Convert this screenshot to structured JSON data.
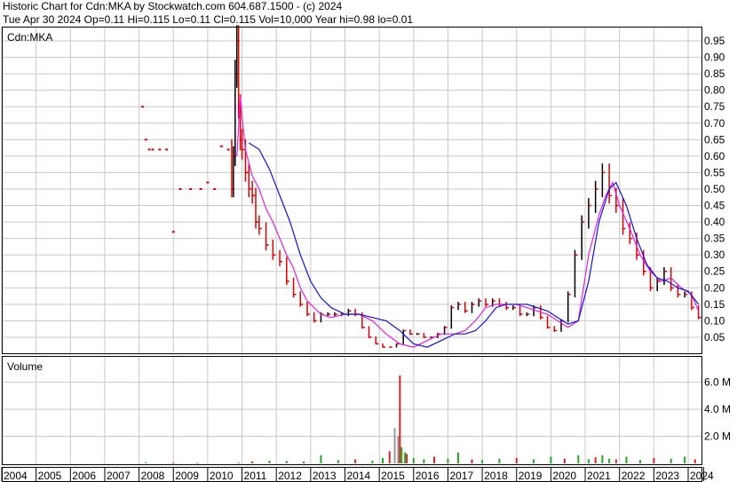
{
  "header": {
    "line1": "Historic Chart for Cdn:MKA by Stockwatch.com 604.687.1500 - (c) 2024",
    "line2": "Tue Apr 30 2024  Op=0.11  Hi=0.115  Lo=0.11  Cl=0.115  Vol=10,000  Year hi=0.98  lo=0.01"
  },
  "colors": {
    "background": "#ffffff",
    "grid": "#c8c8c8",
    "frame": "#000000",
    "price_bar_up": "#000000",
    "price_bar_down": "#dd0000",
    "ma_short": "#e020e0",
    "ma_long": "#1010dd",
    "volume_up": "#22aa22",
    "volume_down": "#dd2222",
    "volume_neutral": "#999999"
  },
  "chart_data": [
    {
      "type": "line",
      "title": "Cdn:MKA",
      "ylim": [
        0,
        0.98
      ],
      "y_ticks": [
        "0.95",
        "0.90",
        "0.85",
        "0.80",
        "0.75",
        "0.70",
        "0.65",
        "0.60",
        "0.55",
        "0.50",
        "0.45",
        "0.40",
        "0.35",
        "0.30",
        "0.25",
        "0.20",
        "0.15",
        "0.10",
        "0.05"
      ],
      "x_ticks": [
        "2004",
        "2005",
        "2006",
        "2007",
        "2008",
        "2009",
        "2010",
        "2011",
        "2012",
        "2013",
        "2014",
        "2015",
        "2016",
        "2017",
        "2018",
        "2019",
        "2020",
        "2021",
        "2022",
        "2023",
        "2024"
      ],
      "grid": true,
      "series": [
        {
          "role": "price",
          "x": [
            2008.1,
            2008.2,
            2008.3,
            2008.4,
            2008.6,
            2008.8,
            2009.0,
            2009.2,
            2009.5,
            2009.8,
            2010.0,
            2010.2,
            2010.4,
            2010.6,
            2010.7,
            2010.75,
            2010.8,
            2010.85,
            2010.9,
            2010.95,
            2011.0,
            2011.1,
            2011.2,
            2011.3,
            2011.4,
            2011.5,
            2011.7,
            2011.9,
            2012.1,
            2012.3,
            2012.5,
            2012.7,
            2012.9,
            2013.1,
            2013.3,
            2013.5,
            2013.7,
            2013.9,
            2014.1,
            2014.3,
            2014.5,
            2014.7,
            2014.9,
            2015.1,
            2015.3,
            2015.5,
            2015.7,
            2015.9,
            2016.1,
            2016.3,
            2016.5,
            2016.7,
            2016.9,
            2017.1,
            2017.3,
            2017.5,
            2017.7,
            2017.9,
            2018.1,
            2018.3,
            2018.5,
            2018.7,
            2018.9,
            2019.1,
            2019.3,
            2019.5,
            2019.7,
            2019.9,
            2020.1,
            2020.3,
            2020.5,
            2020.7,
            2020.9,
            2021.1,
            2021.3,
            2021.5,
            2021.7,
            2021.9,
            2022.1,
            2022.3,
            2022.5,
            2022.7,
            2022.9,
            2023.1,
            2023.3,
            2023.5,
            2023.7,
            2023.9,
            2024.1,
            2024.3
          ],
          "values": [
            0.75,
            0.65,
            0.62,
            0.62,
            0.62,
            0.62,
            0.37,
            0.5,
            0.5,
            0.5,
            0.52,
            0.5,
            0.63,
            0.62,
            0.5,
            0.6,
            0.85,
            0.95,
            0.75,
            0.65,
            0.62,
            0.55,
            0.5,
            0.48,
            0.4,
            0.38,
            0.33,
            0.3,
            0.28,
            0.22,
            0.18,
            0.15,
            0.12,
            0.1,
            0.12,
            0.12,
            0.12,
            0.12,
            0.13,
            0.12,
            0.08,
            0.05,
            0.03,
            0.02,
            0.02,
            0.03,
            0.07,
            0.06,
            0.06,
            0.05,
            0.05,
            0.06,
            0.08,
            0.14,
            0.15,
            0.13,
            0.15,
            0.16,
            0.15,
            0.16,
            0.15,
            0.14,
            0.14,
            0.12,
            0.12,
            0.14,
            0.11,
            0.08,
            0.07,
            0.1,
            0.18,
            0.3,
            0.4,
            0.45,
            0.5,
            0.55,
            0.48,
            0.45,
            0.38,
            0.35,
            0.3,
            0.25,
            0.2,
            0.22,
            0.25,
            0.2,
            0.18,
            0.18,
            0.14,
            0.11
          ]
        },
        {
          "role": "moving-average-short",
          "x": [
            2010.85,
            2010.95,
            2011.0,
            2011.1,
            2011.3,
            2011.5,
            2011.7,
            2011.9,
            2012.1,
            2012.3,
            2012.5,
            2012.7,
            2012.9,
            2013.1,
            2013.3,
            2013.6,
            2014.0,
            2014.4,
            2014.8,
            2015.2,
            2015.6,
            2016.0,
            2016.4,
            2016.8,
            2017.2,
            2017.5,
            2017.8,
            2018.1,
            2018.4,
            2018.7,
            2019.0,
            2019.3,
            2019.6,
            2019.9,
            2020.2,
            2020.5,
            2020.8,
            2021.1,
            2021.4,
            2021.6,
            2021.8,
            2022.0,
            2022.3,
            2022.6,
            2022.9,
            2023.2,
            2023.5,
            2023.8,
            2024.1,
            2024.3
          ],
          "values": [
            0.6,
            0.78,
            0.72,
            0.62,
            0.54,
            0.5,
            0.44,
            0.4,
            0.35,
            0.3,
            0.26,
            0.2,
            0.16,
            0.14,
            0.12,
            0.11,
            0.12,
            0.12,
            0.1,
            0.06,
            0.03,
            0.02,
            0.04,
            0.06,
            0.06,
            0.07,
            0.1,
            0.14,
            0.15,
            0.15,
            0.15,
            0.14,
            0.13,
            0.12,
            0.1,
            0.08,
            0.1,
            0.3,
            0.42,
            0.48,
            0.52,
            0.45,
            0.38,
            0.3,
            0.25,
            0.22,
            0.23,
            0.2,
            0.18,
            0.13
          ]
        },
        {
          "role": "moving-average-long",
          "x": [
            2011.2,
            2011.5,
            2011.8,
            2012.1,
            2012.4,
            2012.7,
            2013.0,
            2013.3,
            2013.6,
            2014.0,
            2014.4,
            2014.8,
            2015.2,
            2015.6,
            2016.0,
            2016.4,
            2016.8,
            2017.2,
            2017.5,
            2017.8,
            2018.1,
            2018.4,
            2018.7,
            2019.0,
            2019.3,
            2019.6,
            2019.9,
            2020.2,
            2020.5,
            2020.8,
            2021.1,
            2021.4,
            2021.7,
            2021.9,
            2022.2,
            2022.5,
            2022.8,
            2023.1,
            2023.4,
            2023.7,
            2024.0,
            2024.3
          ],
          "values": [
            0.64,
            0.62,
            0.56,
            0.48,
            0.4,
            0.3,
            0.22,
            0.17,
            0.14,
            0.12,
            0.12,
            0.11,
            0.1,
            0.07,
            0.03,
            0.02,
            0.04,
            0.06,
            0.06,
            0.07,
            0.1,
            0.14,
            0.15,
            0.15,
            0.15,
            0.14,
            0.13,
            0.11,
            0.09,
            0.1,
            0.22,
            0.4,
            0.5,
            0.52,
            0.45,
            0.35,
            0.27,
            0.23,
            0.22,
            0.2,
            0.19,
            0.15
          ]
        }
      ]
    },
    {
      "type": "bar",
      "title": "Volume",
      "ylim": [
        0,
        7000000
      ],
      "y_ticks": [
        "6.0 M",
        "4.0 M",
        "2.0 M"
      ],
      "grid": true,
      "series": [
        {
          "name": "Volume",
          "x": [
            2008.2,
            2009.0,
            2009.7,
            2010.9,
            2011.3,
            2011.8,
            2012.3,
            2012.8,
            2013.3,
            2013.8,
            2014.3,
            2014.8,
            2015.1,
            2015.3,
            2015.45,
            2015.55,
            2015.6,
            2015.65,
            2015.75,
            2015.8,
            2016.0,
            2016.3,
            2016.6,
            2017.0,
            2017.3,
            2017.7,
            2018.0,
            2018.5,
            2019.0,
            2019.5,
            2020.0,
            2020.4,
            2020.8,
            2021.1,
            2021.3,
            2021.5,
            2021.7,
            2021.9,
            2022.2,
            2022.6,
            2023.0,
            2023.5,
            2023.9,
            2024.2
          ],
          "values": [
            80000,
            60000,
            50000,
            60000,
            150000,
            200000,
            180000,
            120000,
            600000,
            250000,
            300000,
            200000,
            400000,
            900000,
            2600000,
            2000000,
            6500000,
            1200000,
            800000,
            700000,
            400000,
            300000,
            500000,
            350000,
            800000,
            300000,
            250000,
            350000,
            400000,
            300000,
            500000,
            350000,
            600000,
            300000,
            450000,
            600000,
            350000,
            300000,
            500000,
            250000,
            400000,
            350000,
            500000,
            300000
          ]
        }
      ]
    }
  ]
}
